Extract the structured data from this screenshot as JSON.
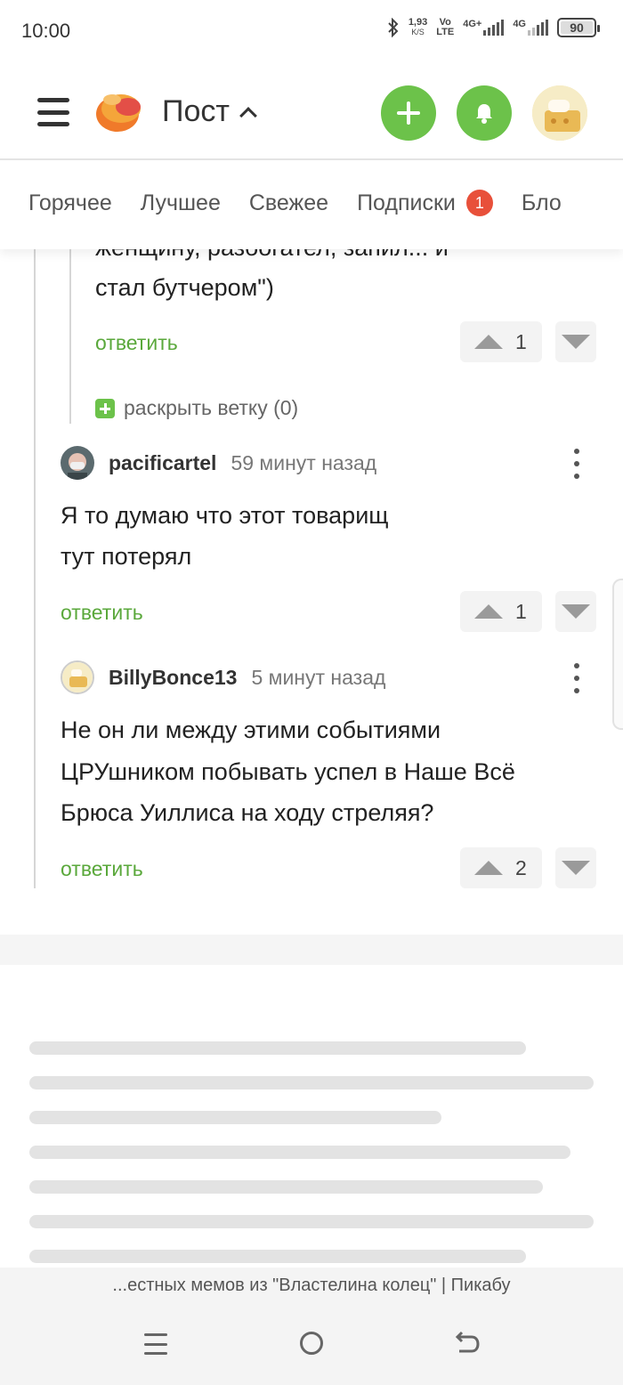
{
  "status_bar": {
    "time": "10:00",
    "speed_value": "1,93",
    "speed_unit": "K/S",
    "volte_top": "Vo",
    "volte_bottom": "LTE",
    "net1": "4G+",
    "net2": "4G",
    "battery": "90"
  },
  "header": {
    "title": "Пост"
  },
  "tabs": [
    {
      "label": "Горячее"
    },
    {
      "label": "Лучшее"
    },
    {
      "label": "Свежее"
    },
    {
      "label": "Подписки",
      "badge": "1"
    },
    {
      "label": "Бло"
    }
  ],
  "comments": {
    "parent_tail": {
      "partial_line": "женщину, разбогател, запил... и",
      "text_line": "стал бутчером\")",
      "reply": "ответить",
      "votes": "1"
    },
    "expand_thread": "раскрыть ветку (0)",
    "items": [
      {
        "author": "pacificartel",
        "time": "59 минут назад",
        "text_lines": [
          "Я то думаю что этот товарищ",
          "тут потерял"
        ],
        "reply": "ответить",
        "votes": "1"
      },
      {
        "author": "BillyBonce13",
        "time": "5 минут назад",
        "text_lines": [
          "Не он ли между этими событиями",
          "ЦРУшником побывать успел в Наше Всё",
          "Брюса Уиллиса на ходу стреляя?"
        ],
        "reply": "ответить",
        "votes": "2"
      }
    ]
  },
  "browser": {
    "page_title": "...естных мемов из \"Властелина колец\" | Пикабу"
  },
  "colors": {
    "accent_green": "#6cc24a",
    "link_green": "#5aa83b",
    "badge_red": "#e8503a"
  },
  "icons": [
    "menu-icon",
    "pikabu-logo",
    "plus-icon",
    "bell-icon",
    "avatar",
    "chevron-up-icon",
    "vote-up-icon",
    "vote-down-icon",
    "more-vert-icon",
    "expand-plus-icon"
  ]
}
